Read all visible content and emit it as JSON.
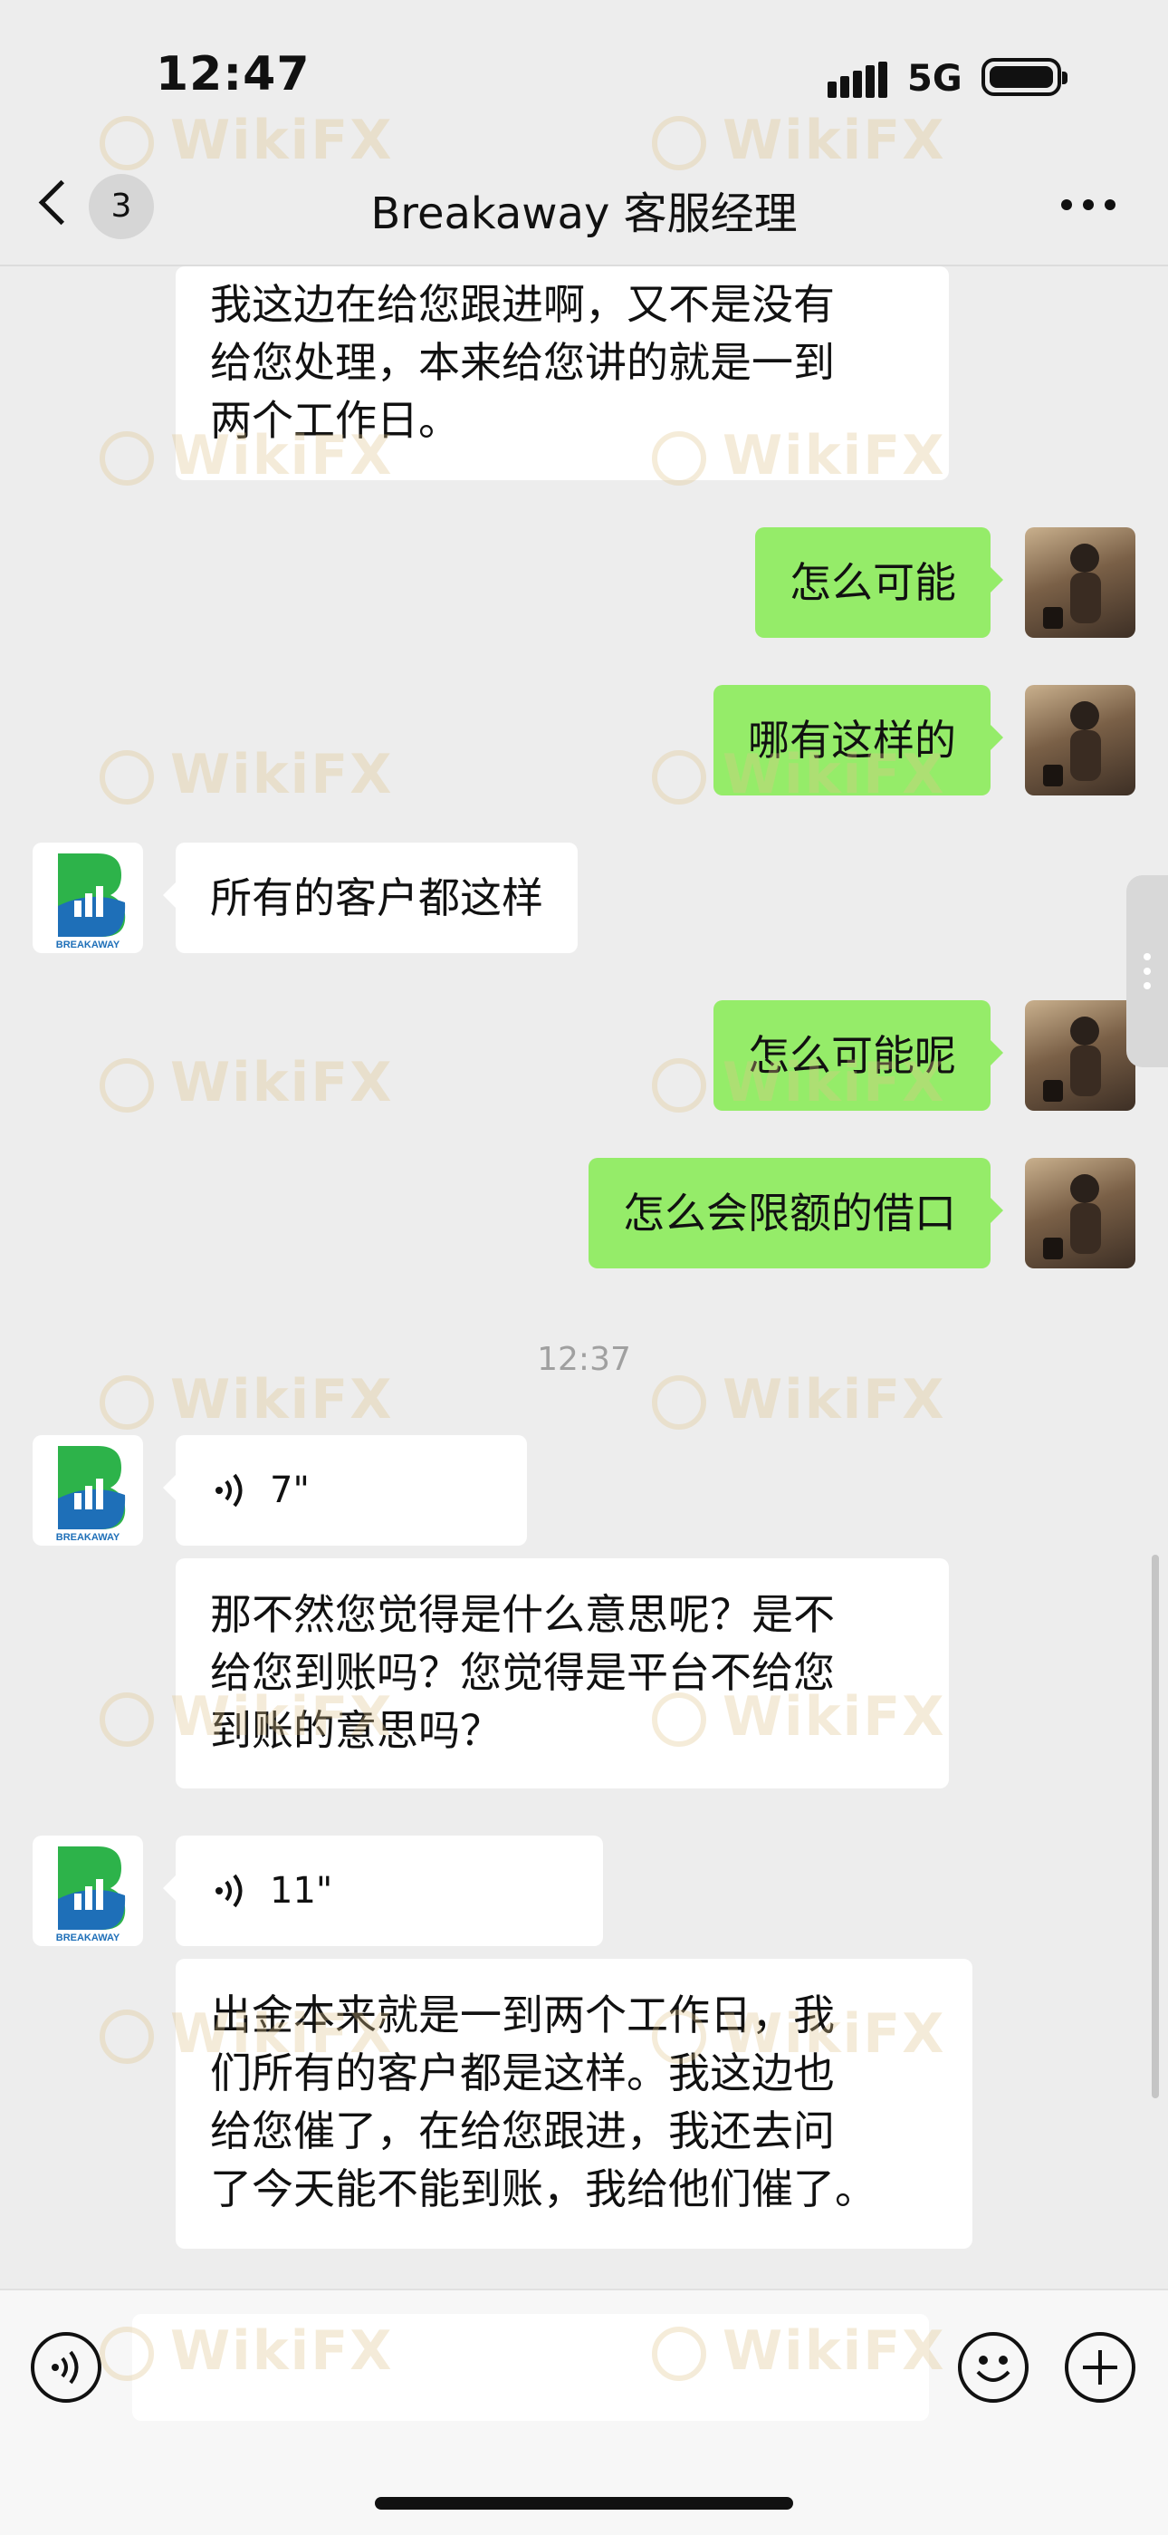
{
  "status_bar": {
    "time": "12:47",
    "network": "5G"
  },
  "nav": {
    "back_count": "3",
    "title": "Breakaway 客服经理"
  },
  "messages": {
    "m1_lines": [
      "我这边在给您跟进啊，又不是没有",
      "给您处理，本来给您讲的就是一到",
      "两个工作日。"
    ],
    "m2": "怎么可能",
    "m3": "哪有这样的",
    "m4": "所有的客户都这样",
    "m5": "怎么可能呢",
    "m6": "怎么会限额的借口",
    "time_divider": "12:37",
    "voice1_duration": "7\"",
    "m7_lines": [
      "那不然您觉得是什么意思呢？是不",
      "给您到账吗？您觉得是平台不给您",
      "到账的意思吗？"
    ],
    "voice2_duration": "11\"",
    "m8_lines": [
      "出金本来就是一到两个工作日，我",
      "们所有的客户都是这样。我这边也",
      "给您催了，在给您跟进，我还去问",
      "了今天能不能到账，我给他们催了。"
    ]
  },
  "contact": {
    "logo_text": "BREAKAWAY",
    "logo_letter": "B"
  },
  "watermark": "WikiFX",
  "colors": {
    "sent_bubble": "#95ec69",
    "received_bubble": "#ffffff",
    "background": "#ededed",
    "logo_green": "#2db34a",
    "logo_blue": "#1e6fb8"
  }
}
